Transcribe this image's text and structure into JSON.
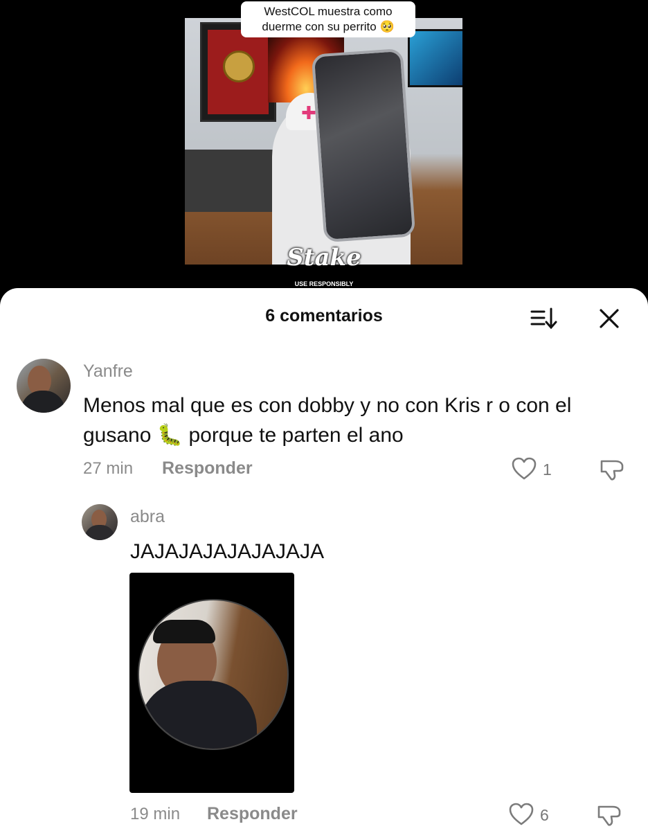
{
  "video": {
    "caption": "WestCOL muestra como duerme con su perrito 🥺",
    "sponsor_logo": "Stake",
    "sponsor_tagline": "USE RESPONSIBLY"
  },
  "comments_sheet": {
    "title": "6 comentarios",
    "sort_icon": "sort-icon",
    "close_icon": "close-icon"
  },
  "comments": [
    {
      "username": "Yanfre",
      "text": "Menos mal que es con dobby y no con Kris r o con el gusano 🐛 porque te parten el ano",
      "time": "27 min",
      "reply_label": "Responder",
      "likes": "1"
    },
    {
      "username": "abra",
      "text": "JAJAJAJAJAJAJAJA",
      "time": "19 min",
      "reply_label": "Responder",
      "likes": "6"
    }
  ],
  "colors": {
    "sheet_bg": "#ffffff",
    "text_primary": "#111111",
    "text_secondary": "#8a8a8a"
  }
}
